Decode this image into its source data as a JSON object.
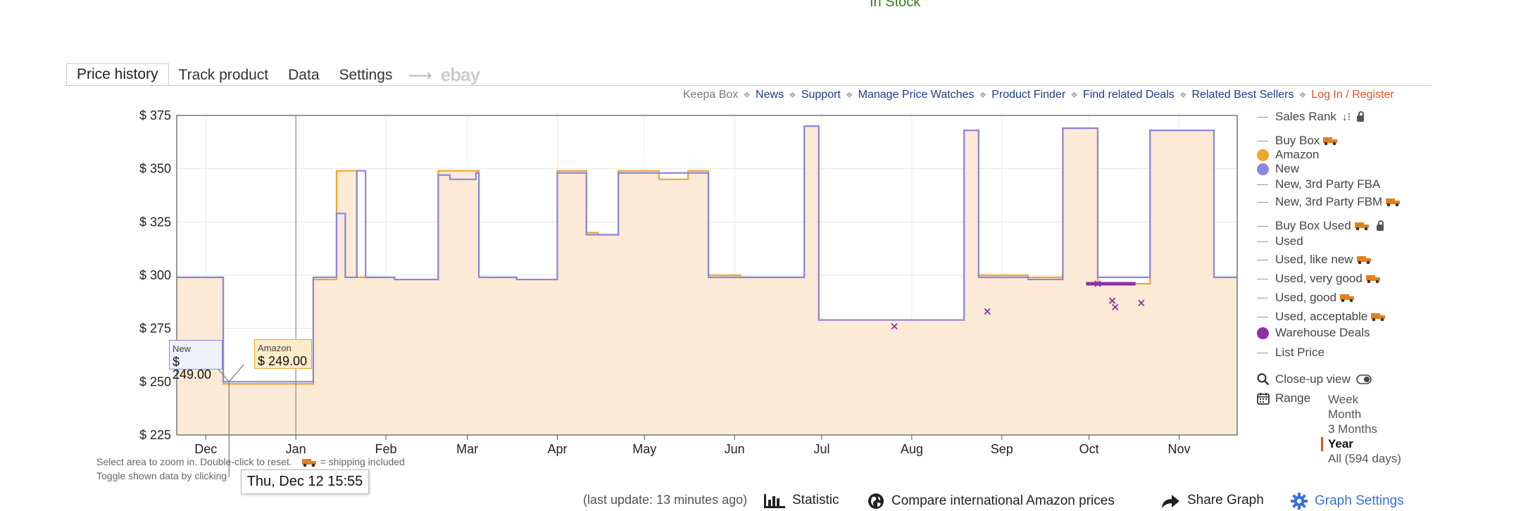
{
  "stock_status": "In Stock",
  "tabs": [
    {
      "label": "Price history"
    },
    {
      "label": "Track product"
    },
    {
      "label": "Data"
    },
    {
      "label": "Settings"
    }
  ],
  "ebay_label": "ebay",
  "links": {
    "keepa_box": "Keepa Box",
    "items": [
      "News",
      "Support",
      "Manage Price Watches",
      "Product Finder",
      "Find related Deals",
      "Related Best Sellers"
    ],
    "login": "Log In / Register"
  },
  "legend": {
    "sales_rank": "Sales Rank",
    "buy_box": "Buy Box",
    "amazon": "Amazon",
    "new": "New",
    "new_fba": "New, 3rd Party FBA",
    "new_fbm": "New, 3rd Party FBM",
    "buy_box_used": "Buy Box Used",
    "used": "Used",
    "used_like_new": "Used, like new",
    "used_very_good": "Used, very good",
    "used_good": "Used, good",
    "used_acceptable": "Used, acceptable",
    "warehouse": "Warehouse Deals",
    "list_price": "List Price",
    "closeup": "Close-up view",
    "range_label": "Range",
    "range_options": [
      "Week",
      "Month",
      "3 Months",
      "Year",
      "All (594 days)"
    ],
    "range_selected": "Year"
  },
  "colors": {
    "amazon": "#f0a52c",
    "amazon_fill": "#fbe6cf",
    "new": "#8888dd",
    "warehouse": "#8e2fa8",
    "accent": "#e2521d",
    "link": "#1a3e8c"
  },
  "hints": {
    "line1": "Select area to zoom in. Double-click to reset.",
    "shipping": "= shipping included",
    "line2": "Toggle shown data by clicking"
  },
  "tooltip_date": "Thu, Dec 12 15:55",
  "labels": {
    "new_title": "New",
    "new_price": "$ 249.00",
    "amazon_title": "Amazon",
    "amazon_price": "$ 249.00"
  },
  "bottom": {
    "last_update": "(last update: 13 minutes ago)",
    "statistic": "Statistic",
    "compare": "Compare international Amazon prices",
    "share": "Share Graph",
    "settings": "Graph Settings"
  },
  "chart_data": {
    "type": "line",
    "x_unit": "days",
    "x_range": [
      0,
      365
    ],
    "ylim": [
      225,
      375
    ],
    "yticks": [
      225,
      250,
      275,
      300,
      325,
      350,
      375
    ],
    "ytick_labels": [
      "$ 225",
      "$ 250",
      "$ 275",
      "$ 300",
      "$ 325",
      "$ 350",
      "$ 375"
    ],
    "xticks": [
      {
        "label": "Dec",
        "x": 10
      },
      {
        "label": "Jan",
        "x": 41
      },
      {
        "label": "Feb",
        "x": 72
      },
      {
        "label": "Mar",
        "x": 100
      },
      {
        "label": "Apr",
        "x": 131
      },
      {
        "label": "May",
        "x": 161
      },
      {
        "label": "Jun",
        "x": 192
      },
      {
        "label": "Jul",
        "x": 222
      },
      {
        "label": "Aug",
        "x": 253
      },
      {
        "label": "Sep",
        "x": 284
      },
      {
        "label": "Oct",
        "x": 314
      },
      {
        "label": "Nov",
        "x": 345
      }
    ],
    "series": [
      {
        "name": "Amazon",
        "points": [
          [
            0,
            299
          ],
          [
            16,
            299
          ],
          [
            16,
            249
          ],
          [
            47,
            249
          ],
          [
            47,
            298
          ],
          [
            55,
            298
          ],
          [
            55,
            349
          ],
          [
            62,
            349
          ],
          [
            62,
            299
          ],
          [
            75,
            299
          ],
          [
            75,
            298
          ],
          [
            90,
            298
          ],
          [
            90,
            349
          ],
          [
            104,
            349
          ],
          [
            104,
            299
          ],
          [
            117,
            299
          ],
          [
            117,
            298
          ],
          [
            131,
            298
          ],
          [
            131,
            349
          ],
          [
            141,
            349
          ],
          [
            141,
            320
          ],
          [
            145,
            320
          ],
          [
            145,
            319
          ],
          [
            152,
            319
          ],
          [
            152,
            349
          ],
          [
            166,
            349
          ],
          [
            166,
            345
          ],
          [
            176,
            345
          ],
          [
            176,
            349
          ],
          [
            183,
            349
          ],
          [
            183,
            300
          ],
          [
            194,
            300
          ],
          [
            194,
            299
          ],
          [
            216,
            299
          ],
          [
            216,
            370
          ],
          [
            221,
            370
          ],
          [
            221,
            279
          ],
          [
            253,
            279
          ],
          [
            253,
            279
          ],
          [
            271,
            279
          ],
          [
            271,
            368
          ],
          [
            276,
            368
          ],
          [
            276,
            300
          ],
          [
            293,
            300
          ],
          [
            293,
            299
          ],
          [
            305,
            299
          ],
          [
            305,
            369
          ],
          [
            317,
            369
          ],
          [
            317,
            296
          ],
          [
            335,
            296
          ],
          [
            335,
            368
          ],
          [
            357,
            368
          ],
          [
            357,
            299
          ],
          [
            365,
            299
          ]
        ]
      },
      {
        "name": "New",
        "points": [
          [
            0,
            299
          ],
          [
            16,
            299
          ],
          [
            16,
            250
          ],
          [
            47,
            250
          ],
          [
            47,
            299
          ],
          [
            55,
            299
          ],
          [
            55,
            329
          ],
          [
            58,
            329
          ],
          [
            58,
            299
          ],
          [
            62,
            299
          ],
          [
            62,
            349
          ],
          [
            65,
            349
          ],
          [
            65,
            299
          ],
          [
            75,
            299
          ],
          [
            75,
            298
          ],
          [
            90,
            298
          ],
          [
            90,
            347
          ],
          [
            94,
            347
          ],
          [
            94,
            345
          ],
          [
            103,
            345
          ],
          [
            103,
            348
          ],
          [
            104,
            348
          ],
          [
            104,
            299
          ],
          [
            117,
            299
          ],
          [
            117,
            298
          ],
          [
            131,
            298
          ],
          [
            131,
            348
          ],
          [
            141,
            348
          ],
          [
            141,
            319
          ],
          [
            152,
            319
          ],
          [
            152,
            348
          ],
          [
            183,
            348
          ],
          [
            183,
            299
          ],
          [
            216,
            299
          ],
          [
            216,
            370
          ],
          [
            221,
            370
          ],
          [
            221,
            279
          ],
          [
            253,
            279
          ],
          [
            253,
            279
          ],
          [
            271,
            279
          ],
          [
            271,
            368
          ],
          [
            276,
            368
          ],
          [
            276,
            299
          ],
          [
            293,
            299
          ],
          [
            293,
            298
          ],
          [
            305,
            298
          ],
          [
            305,
            369
          ],
          [
            317,
            369
          ],
          [
            317,
            299
          ],
          [
            335,
            299
          ],
          [
            335,
            368
          ],
          [
            357,
            368
          ],
          [
            357,
            299
          ],
          [
            365,
            299
          ]
        ]
      },
      {
        "name": "Warehouse Deals",
        "points": [
          [
            247,
            276
          ],
          [
            279,
            283
          ],
          [
            317,
            296
          ],
          [
            322,
            288
          ],
          [
            323,
            285
          ],
          [
            332,
            287
          ]
        ]
      }
    ]
  }
}
